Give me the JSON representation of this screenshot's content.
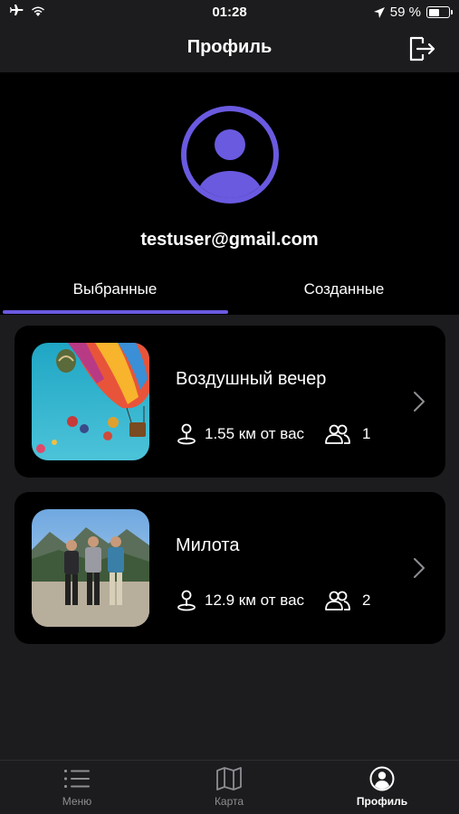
{
  "status_bar": {
    "time": "01:28",
    "battery_percent": "59 %",
    "battery_level": 0.59
  },
  "nav": {
    "title": "Профиль"
  },
  "profile": {
    "email": "testuser@gmail.com",
    "accent_color": "#6a5ae0"
  },
  "tabs": [
    {
      "label": "Выбранные",
      "selected": true
    },
    {
      "label": "Созданные",
      "selected": false
    }
  ],
  "events": [
    {
      "title": "Воздушный вечер",
      "distance": "1.55 км от вас",
      "participants": "1"
    },
    {
      "title": "Милота",
      "distance": "12.9 км от вас",
      "participants": "2"
    }
  ],
  "tab_bar": {
    "items": [
      {
        "label": "Меню",
        "icon": "list-icon",
        "active": false
      },
      {
        "label": "Карта",
        "icon": "map-icon",
        "active": false
      },
      {
        "label": "Профиль",
        "icon": "profile-icon",
        "active": true
      }
    ]
  }
}
